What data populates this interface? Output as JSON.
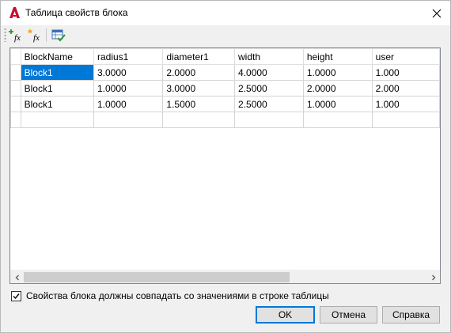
{
  "window": {
    "title": "Таблица свойств блока",
    "accent_color": "#0078d7",
    "app_icon": "autocad-logo-icon"
  },
  "toolbar": {
    "buttons": [
      {
        "icon": "add-fx-icon",
        "label": "fx"
      },
      {
        "icon": "user-fx-icon",
        "label": "fx"
      },
      {
        "icon": "audit-table-icon"
      }
    ]
  },
  "table": {
    "columns": [
      "BlockName",
      "radius1",
      "diameter1",
      "width",
      "height",
      "user"
    ],
    "rows": [
      [
        "Block1",
        "3.0000",
        "2.0000",
        "4.0000",
        "1.0000",
        "1.000"
      ],
      [
        "Block1",
        "1.0000",
        "3.0000",
        "2.5000",
        "2.0000",
        "2.000"
      ],
      [
        "Block1",
        "1.0000",
        "1.5000",
        "2.5000",
        "1.0000",
        "1.000"
      ]
    ],
    "selected_cell": "Block1"
  },
  "scrollbar": {
    "position": 0.0,
    "visible_fraction": 0.65
  },
  "checkbox": {
    "label": "Свойства блока должны совпадать со значениями в строке таблицы",
    "checked": true
  },
  "buttons": {
    "ok": "OK",
    "cancel": "Отмена",
    "help": "Справка"
  }
}
